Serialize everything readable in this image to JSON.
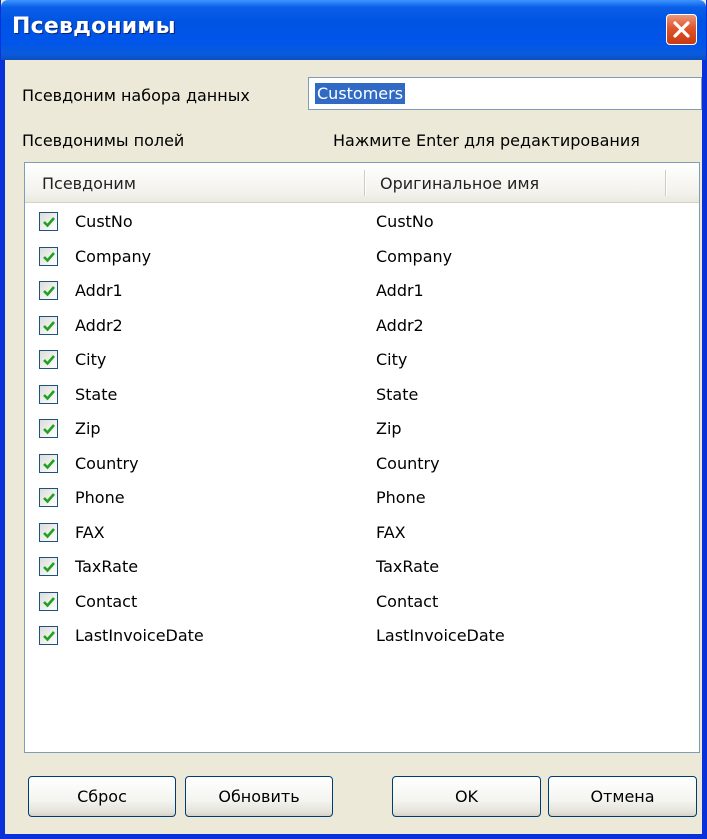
{
  "window": {
    "title": "Псевдонимы"
  },
  "dataset": {
    "label": "Псевдоним набора данных",
    "value": "Customers"
  },
  "fields": {
    "label": "Псевдонимы полей",
    "hint": "Нажмите Enter для редактирования",
    "columns": [
      "Псевдоним",
      "Оригинальное имя"
    ],
    "rows": [
      {
        "checked": true,
        "alias": "CustNo",
        "original": "CustNo"
      },
      {
        "checked": true,
        "alias": "Company",
        "original": "Company"
      },
      {
        "checked": true,
        "alias": "Addr1",
        "original": "Addr1"
      },
      {
        "checked": true,
        "alias": "Addr2",
        "original": "Addr2"
      },
      {
        "checked": true,
        "alias": "City",
        "original": "City"
      },
      {
        "checked": true,
        "alias": "State",
        "original": "State"
      },
      {
        "checked": true,
        "alias": "Zip",
        "original": "Zip"
      },
      {
        "checked": true,
        "alias": "Country",
        "original": "Country"
      },
      {
        "checked": true,
        "alias": "Phone",
        "original": "Phone"
      },
      {
        "checked": true,
        "alias": "FAX",
        "original": "FAX"
      },
      {
        "checked": true,
        "alias": "TaxRate",
        "original": "TaxRate"
      },
      {
        "checked": true,
        "alias": "Contact",
        "original": "Contact"
      },
      {
        "checked": true,
        "alias": "LastInvoiceDate",
        "original": "LastInvoiceDate"
      }
    ]
  },
  "buttons": {
    "reset": "Сброс",
    "update": "Обновить",
    "ok": "OK",
    "cancel": "Отмена"
  },
  "colors": {
    "titlebar": "#0054e3",
    "selection": "#316ac5",
    "check": "#21a121",
    "close": "#e1552c"
  }
}
